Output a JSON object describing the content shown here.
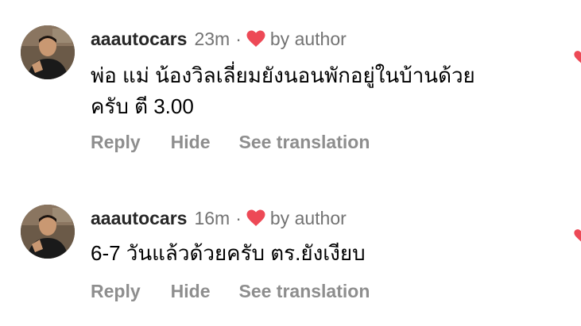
{
  "comments": [
    {
      "username": "aaautocars",
      "time": "23m",
      "separator": "·",
      "by_author": "by author",
      "text_lines": [
        "พ่อ แม่ น้องวิลเลี่ยมยังนอนพักอยู่ในบ้านด้วย",
        "ครับ ตี 3.00"
      ],
      "actions": {
        "reply": "Reply",
        "hide": "Hide",
        "translate": "See translation"
      }
    },
    {
      "username": "aaautocars",
      "time": "16m",
      "separator": "·",
      "by_author": "by author",
      "text_lines": [
        "6-7 วันแล้วด้วยครับ ตร.ยังเงียบ"
      ],
      "actions": {
        "reply": "Reply",
        "hide": "Hide",
        "translate": "See translation"
      }
    }
  ],
  "colors": {
    "heart": "#ed4956",
    "secondary_text": "#737373",
    "action_text": "#8e8e8e"
  },
  "icons": {
    "author_heart": "heart-icon",
    "like": "heart-icon"
  }
}
